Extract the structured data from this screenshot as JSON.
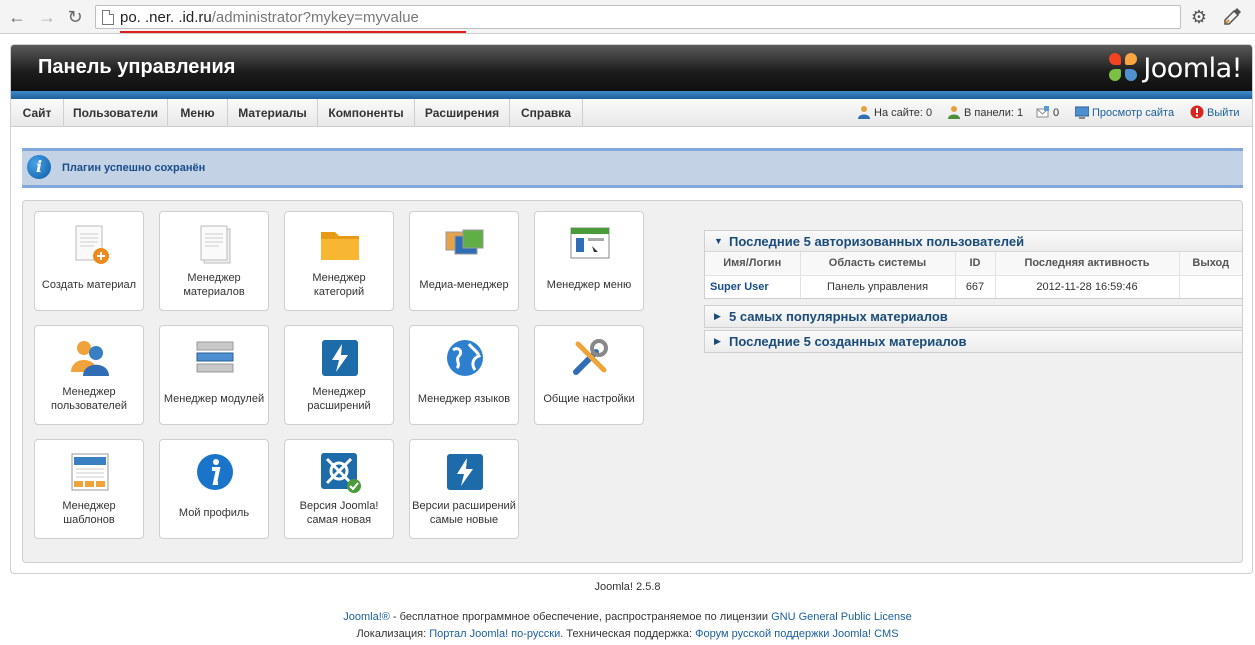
{
  "browser": {
    "url_host": "po.   .ner.   .id.ru",
    "url_path": "/administrator?mykey=myvalue"
  },
  "header": {
    "title": "Панель управления",
    "logo_text": "Joomla!"
  },
  "menu": {
    "items": [
      "Сайт",
      "Пользователи",
      "Меню",
      "Материалы",
      "Компоненты",
      "Расширения",
      "Справка"
    ]
  },
  "status": {
    "on_site": "На сайте: 0",
    "in_panel": "В панели: 1",
    "messages": "0",
    "view_site": "Просмотр сайта",
    "logout": "Выйти"
  },
  "message": {
    "text": "Плагин успешно сохранён"
  },
  "tiles": [
    {
      "label": "Создать материал",
      "icon": "article-add-icon"
    },
    {
      "label": "Менеджер материалов",
      "icon": "article-manager-icon"
    },
    {
      "label": "Менеджер категорий",
      "icon": "folder-icon"
    },
    {
      "label": "Медиа-менеджер",
      "icon": "media-icon"
    },
    {
      "label": "Менеджер меню",
      "icon": "menu-manager-icon"
    },
    {
      "label": "Менеджер пользователей",
      "icon": "users-icon"
    },
    {
      "label": "Менеджер модулей",
      "icon": "modules-icon"
    },
    {
      "label": "Менеджер расширений",
      "icon": "extensions-icon"
    },
    {
      "label": "Менеджер языков",
      "icon": "globe-icon"
    },
    {
      "label": "Общие настройки",
      "icon": "tools-icon"
    },
    {
      "label": "Менеджер шаблонов",
      "icon": "templates-icon"
    },
    {
      "label": "Мой профиль",
      "icon": "info-icon"
    },
    {
      "label": "Версия Joomla! самая новая",
      "icon": "joomla-update-icon"
    },
    {
      "label": "Версии расширений самые новые",
      "icon": "extensions-update-icon"
    }
  ],
  "panels": {
    "users": {
      "title": "Последние 5 авторизованных пользователей",
      "columns": [
        "Имя/Логин",
        "Область системы",
        "ID",
        "Последняя активность",
        "Выход"
      ],
      "rows": [
        {
          "name": "Super User",
          "area": "Панель управления",
          "id": "667",
          "activity": "2012-11-28 16:59:46",
          "logout": ""
        }
      ]
    },
    "popular": {
      "title": "5 самых популярных материалов"
    },
    "latest": {
      "title": "Последние 5 созданных материалов"
    }
  },
  "footer": {
    "version": "Joomla! 2.5.8",
    "line1_link1": "Joomla!®",
    "line1_text": " - бесплатное программное обеспечение, распространяемое по лицензии ",
    "line1_link2": "GNU General Public License",
    "line2_text1": "Локализация: ",
    "line2_link1": "Портал Joomla! по-русски",
    "line2_text2": ". Техническая поддержка: ",
    "line2_link2": "Форум русской поддержки Joomla! CMS"
  },
  "colors": {
    "accent": "#1a5f9a",
    "header_dark": "#1b1b1b",
    "stripe": "#2f7ab8",
    "message_bg": "#c3d2e5"
  }
}
